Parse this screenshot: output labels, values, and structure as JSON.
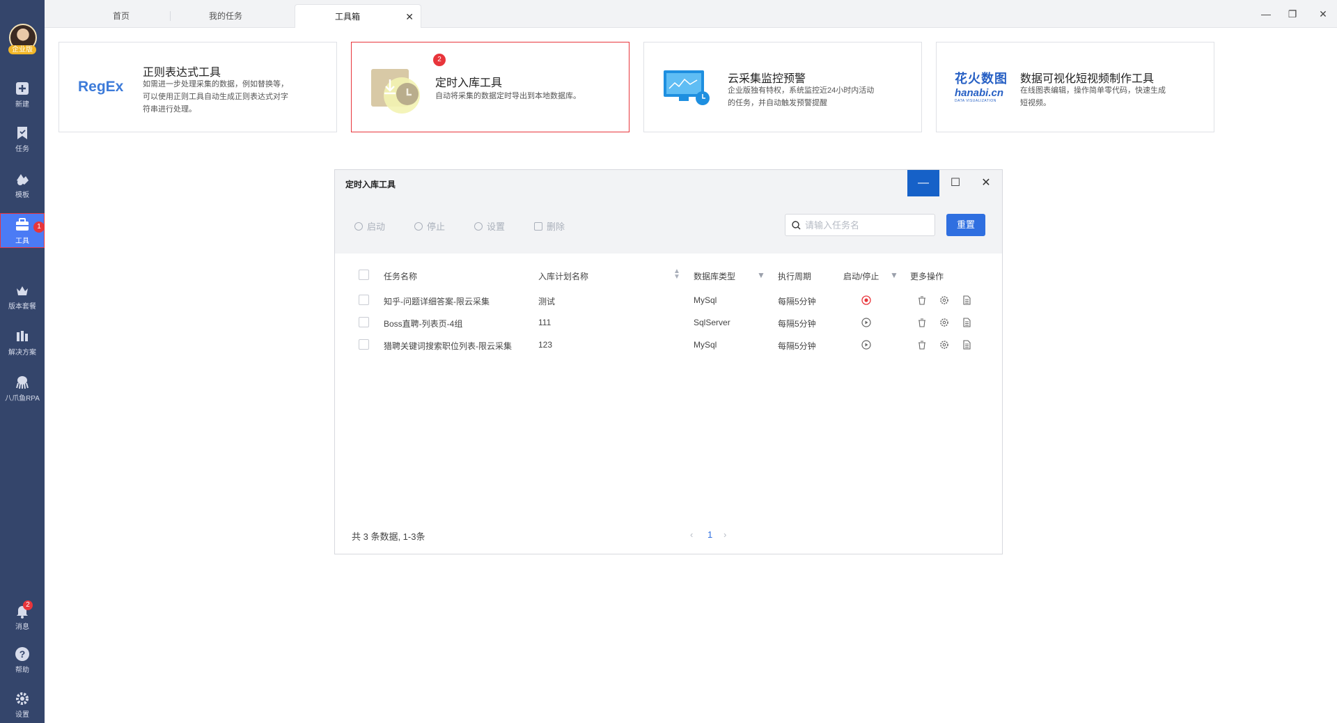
{
  "sidebar": {
    "avatar_badge": "企业版",
    "items": [
      {
        "label": "新建",
        "icon": "plus-square-icon"
      },
      {
        "label": "任务",
        "icon": "bookmark-icon"
      },
      {
        "label": "模板",
        "icon": "template-icon"
      },
      {
        "label": "工具",
        "icon": "toolbox-icon",
        "badge": "1",
        "active": true
      },
      {
        "label": "版本套餐",
        "icon": "crown-icon"
      },
      {
        "label": "解决方案",
        "icon": "solution-icon"
      },
      {
        "label": "八爪鱼RPA",
        "icon": "octopus-icon"
      },
      {
        "label": "消息",
        "icon": "bell-icon",
        "badge": "2"
      },
      {
        "label": "帮助",
        "icon": "question-icon"
      },
      {
        "label": "设置",
        "icon": "gear-icon"
      }
    ]
  },
  "tabs": [
    {
      "label": "首页"
    },
    {
      "label": "我的任务"
    },
    {
      "label": "工具箱",
      "active": true
    }
  ],
  "cards": [
    {
      "title": "正则表达式工具",
      "logo_text": "RegEx",
      "desc_lines": [
        "如需进一步处理采集的数据，例如替换等，",
        "可以使用正则工具自动生成正则表达式对字",
        "符串进行处理。"
      ]
    },
    {
      "title": "定时入库工具",
      "badge": "2",
      "desc_lines": [
        "自动将采集的数据定时导出到本地数据库。"
      ]
    },
    {
      "title": "云采集监控预警",
      "desc_lines": [
        "企业版独有特权，系统监控近24小时内活动",
        "的任务，并自动触发预警提醒"
      ]
    },
    {
      "title": "数据可视化短视频制作工具",
      "logo_cn": "花火数图",
      "logo_en": "hanabi.cn",
      "logo_sub": "DATA VISUALIZATION",
      "desc_lines": [
        "在线图表编辑，操作简单零代码，快速生成",
        "短视频。"
      ]
    }
  ],
  "modal": {
    "title": "定时入库工具",
    "toolbar": {
      "start": "启动",
      "stop": "停止",
      "settings": "设置",
      "delete": "删除"
    },
    "search_placeholder": "请输入任务名",
    "reset": "重置",
    "columns": {
      "name": "任务名称",
      "plan": "入库计划名称",
      "db": "数据库类型",
      "period": "执行周期",
      "toggle": "启动/停止",
      "more": "更多操作"
    },
    "rows": [
      {
        "name": "知乎-问题详细答案-限云采集",
        "plan": "测试",
        "db": "MySql",
        "period": "每隔5分钟",
        "running": true
      },
      {
        "name": "Boss直聘-列表页-4组",
        "plan": "111",
        "db": "SqlServer",
        "period": "每隔5分钟",
        "running": false
      },
      {
        "name": "猎聘关键词搜索职位列表-限云采集",
        "plan": "123",
        "db": "MySql",
        "period": "每隔5分钟",
        "running": false
      }
    ],
    "footer": {
      "summary": "共 3 条数据, 1-3条",
      "page": "1"
    }
  }
}
